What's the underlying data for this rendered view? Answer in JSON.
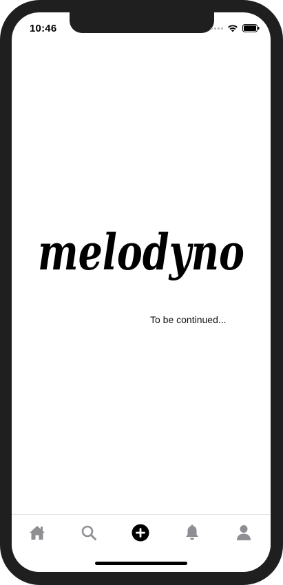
{
  "status_bar": {
    "time": "10:46"
  },
  "main": {
    "logo_text": "melodyno",
    "subtitle": "To be continued..."
  },
  "tab_bar": {
    "items": [
      {
        "icon": "home-icon"
      },
      {
        "icon": "search-icon"
      },
      {
        "icon": "add-icon"
      },
      {
        "icon": "bell-icon"
      },
      {
        "icon": "profile-icon"
      }
    ]
  },
  "colors": {
    "tab_icon": "#8e8e93",
    "active_tab": "#000000",
    "frame": "#1f1f1f"
  }
}
